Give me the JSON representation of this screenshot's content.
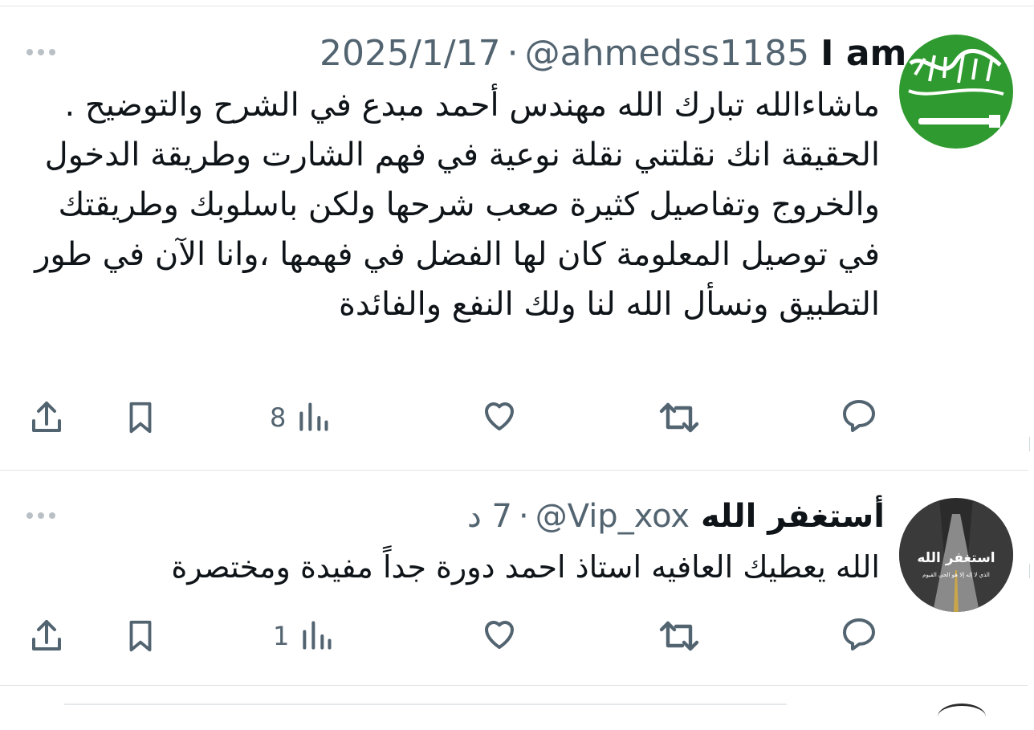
{
  "tweets": [
    {
      "name": "I am",
      "handle": "@ahmedss1185",
      "separator": "·",
      "time": "2025/1/17",
      "text": "ماشاءالله تبارك الله مهندس أحمد مبدع في الشرح والتوضيح . الحقيقة انك نقلتني نقلة نوعية في فهم الشارت وطريقة الدخول والخروج وتفاصيل كثيرة صعب شرحها ولكن باسلوبك وطريقتك في توصيل المعلومة كان لها الفضل في فهمها ،وانا الآن في طور التطبيق ونسأل الله لنا ولك النفع والفائدة",
      "views": "8",
      "avatar_colors": {
        "bg": "#2f9a2f",
        "script": "#ffffff"
      }
    },
    {
      "name": "أستغفر الله",
      "handle": "@Vip_xox",
      "separator": "·",
      "time": "7 د",
      "text": "الله يعطيك العافيه استاذ احمد دورة جداً مفيدة ومختصرة",
      "views": "1",
      "avatar_text": "استغفر الله",
      "avatar_subtext": "الذي لا إله إلا هو الحي القيوم",
      "avatar_colors": {
        "bg": "#2b2b2b",
        "script": "#ffffff"
      }
    }
  ],
  "colors": {
    "text": "#0f1419",
    "muted": "#536471",
    "divider": "#dfe3e6"
  },
  "icons": [
    "more-icon",
    "share-icon",
    "bookmark-icon",
    "views-icon",
    "like-icon",
    "retweet-icon",
    "reply-icon"
  ]
}
